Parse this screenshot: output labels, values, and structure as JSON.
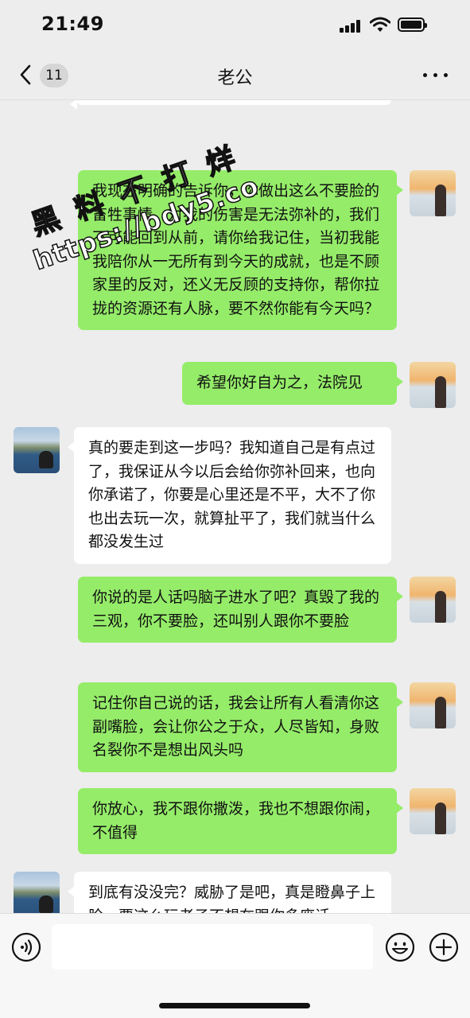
{
  "status_bar": {
    "time": "21:49"
  },
  "header": {
    "back_badge": "11",
    "title": "老公"
  },
  "messages": [
    {
      "from": "me",
      "text": "我现在明确的告诉你，你做出这么不要脸的畜牲事情，对我的伤害是无法弥补的，我们不可能回到从前，请你给我记住，当初我能我陪你从一无所有到今天的成就，也是不顾家里的反对，还义无反顾的支持你，帮你拉拢的资源还有人脉，要不然你能有今天吗？"
    },
    {
      "from": "me",
      "text": "希望你好自为之，法院见"
    },
    {
      "from": "husband",
      "text": "真的要走到这一步吗？我知道自己是有点过了，我保证从今以后会给你弥补回来，也向你承诺了，你要是心里还是不平，大不了你也出去玩一次，就算扯平了，我们就当什么都没发生过"
    },
    {
      "from": "me",
      "text": "你说的是人话吗脑子进水了吧？真毁了我的三观，你不要脸，还叫别人跟你不要脸"
    },
    {
      "from": "me",
      "text": "记住你自己说的话，我会让所有人看清你这副嘴脸，会让你公之于众，人尽皆知，身败名裂你不是想出风头吗"
    },
    {
      "from": "me",
      "text": "你放心，我不跟你撒泼，我也不想跟你闹，不值得"
    },
    {
      "from": "husband",
      "text": "到底有没没完？威胁了是吧，真是瞪鼻子上脸，要这么玩老子不想在跟你多废话"
    }
  ],
  "watermark": {
    "line1": "黑料不打烊",
    "line2": "https://bdy5.co"
  },
  "input": {
    "placeholder": ""
  },
  "colors": {
    "background": "#ededed",
    "outgoing_bubble": "#95ec69",
    "incoming_bubble": "#ffffff"
  }
}
